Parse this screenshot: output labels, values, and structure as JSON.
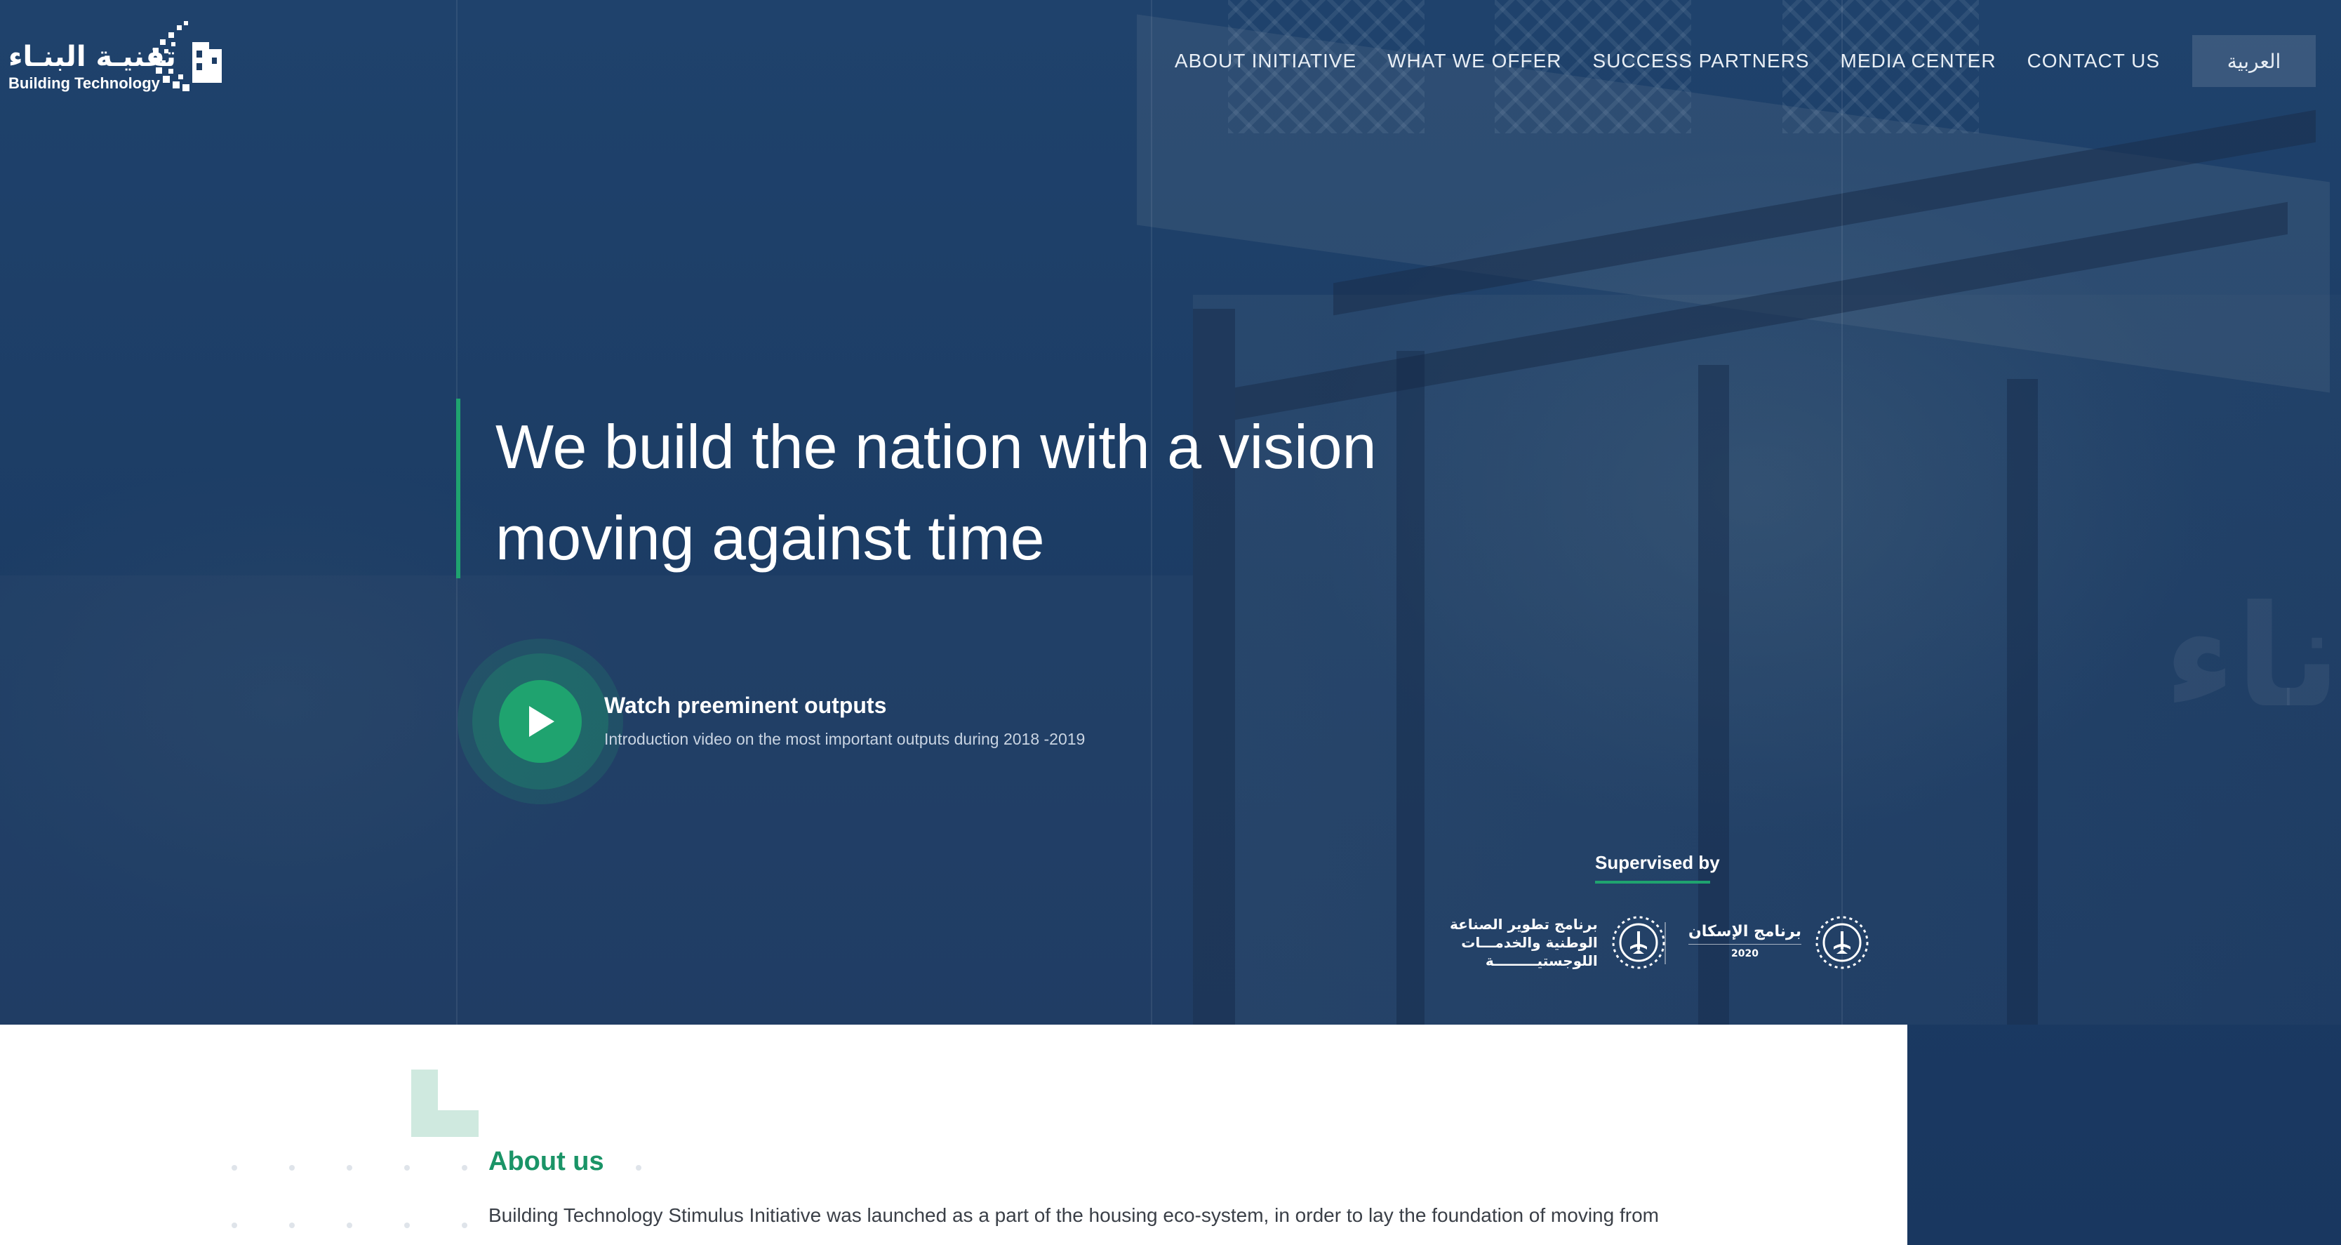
{
  "logo": {
    "arabic": "تقنيـة البنـاء",
    "english": "Building Technology",
    "icon": "building-pixel-logo-icon"
  },
  "nav": {
    "items": [
      {
        "label": "ABOUT INITIATIVE"
      },
      {
        "label": "WHAT WE OFFER"
      },
      {
        "label": "SUCCESS PARTNERS"
      },
      {
        "label": "MEDIA CENTER"
      },
      {
        "label": "CONTACT US"
      }
    ],
    "language": "العربية"
  },
  "hero": {
    "headline_line1": "We build the nation with a vision",
    "headline_line2": "moving against time"
  },
  "video": {
    "title": "Watch preeminent outputs",
    "subtitle": "Introduction video on the most important outputs during 2018 -2019",
    "icon": "play-icon"
  },
  "supervised": {
    "label": "Supervised by",
    "partners": [
      {
        "name_line1": "برنامج تطوير الصناعة",
        "name_line2": "الوطنية والخدمـــات",
        "name_line3": "اللوجستيـــــــــة",
        "icon": "saudi-emblem-icon"
      },
      {
        "name_line1": "برنامج الإسكان",
        "name_line2": "2020",
        "icon": "saudi-emblem-icon"
      }
    ]
  },
  "about": {
    "title": "About us",
    "text": "Building Technology Stimulus Initiative was launched as a part of the housing eco-system, in order to lay the foundation of moving from"
  },
  "colors": {
    "accent_green": "#1fa36f",
    "hero_navy": "#1c3c64",
    "about_title": "#1a9467"
  }
}
